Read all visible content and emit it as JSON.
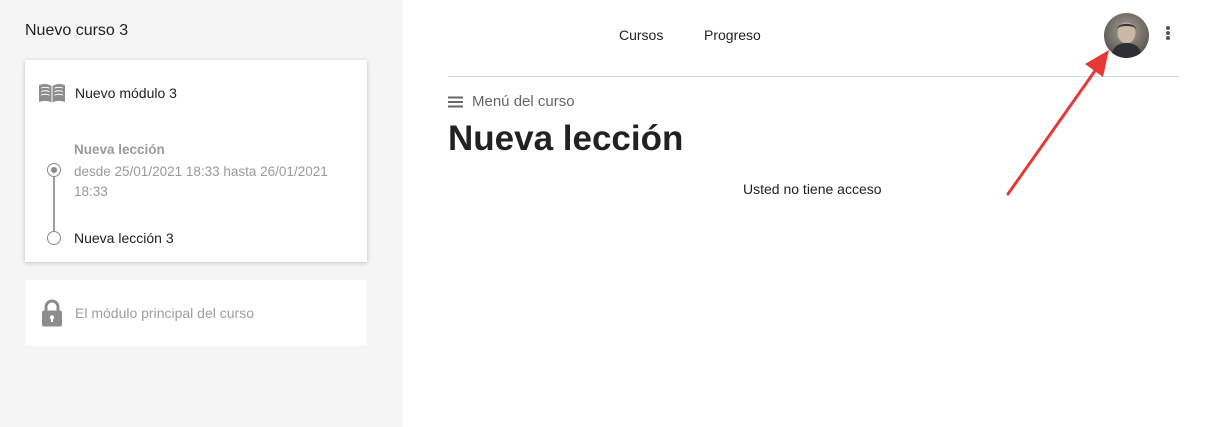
{
  "sidebar": {
    "course_title": "Nuevo curso 3",
    "module": {
      "title": "Nuevo módulo 3",
      "icon": "book-icon",
      "lessons": [
        {
          "title": "Nueva lección",
          "dates": "desde 25/01/2021 18:33 hasta 26/01/2021 18:33",
          "state": "active"
        },
        {
          "title": "Nueva lección 3",
          "state": "default"
        }
      ]
    },
    "locked_module": {
      "title": "El módulo principal del curso",
      "icon": "lock-icon"
    }
  },
  "header": {
    "nav": [
      "Cursos",
      "Progreso"
    ],
    "avatar": "user-avatar",
    "menu_icon": "more-vert-icon"
  },
  "main": {
    "course_menu_label": "Menú del curso",
    "title": "Nueva lección",
    "message": "Usted no tiene acceso"
  },
  "annotation": {
    "color": "#e53935"
  }
}
